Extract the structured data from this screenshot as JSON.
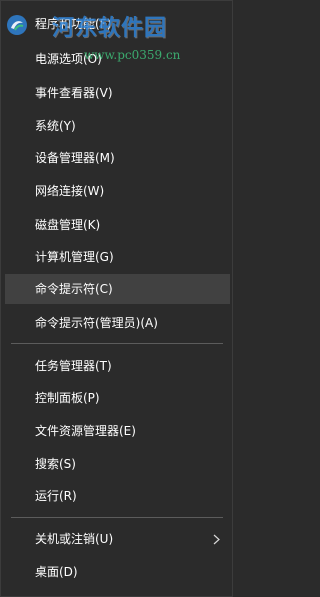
{
  "menu": {
    "items": [
      {
        "label": "程序和功能(F)"
      },
      {
        "label": "电源选项(O)"
      },
      {
        "label": "事件查看器(V)"
      },
      {
        "label": "系统(Y)"
      },
      {
        "label": "设备管理器(M)"
      },
      {
        "label": "网络连接(W)"
      },
      {
        "label": "磁盘管理(K)"
      },
      {
        "label": "计算机管理(G)"
      },
      {
        "label": "命令提示符(C)"
      },
      {
        "label": "命令提示符(管理员)(A)"
      },
      {
        "label": "任务管理器(T)"
      },
      {
        "label": "控制面板(P)"
      },
      {
        "label": "文件资源管理器(E)"
      },
      {
        "label": "搜索(S)"
      },
      {
        "label": "运行(R)"
      },
      {
        "label": "关机或注销(U)"
      },
      {
        "label": "桌面(D)"
      }
    ],
    "hovered_item": "命令提示符(C)",
    "colors": {
      "background": "#2b2b2b",
      "hover": "#414141",
      "text": "#ffffff",
      "divider": "#5c5c5c"
    }
  },
  "watermark": {
    "title": "河东软件园",
    "url": "www.pc0359.cn"
  }
}
